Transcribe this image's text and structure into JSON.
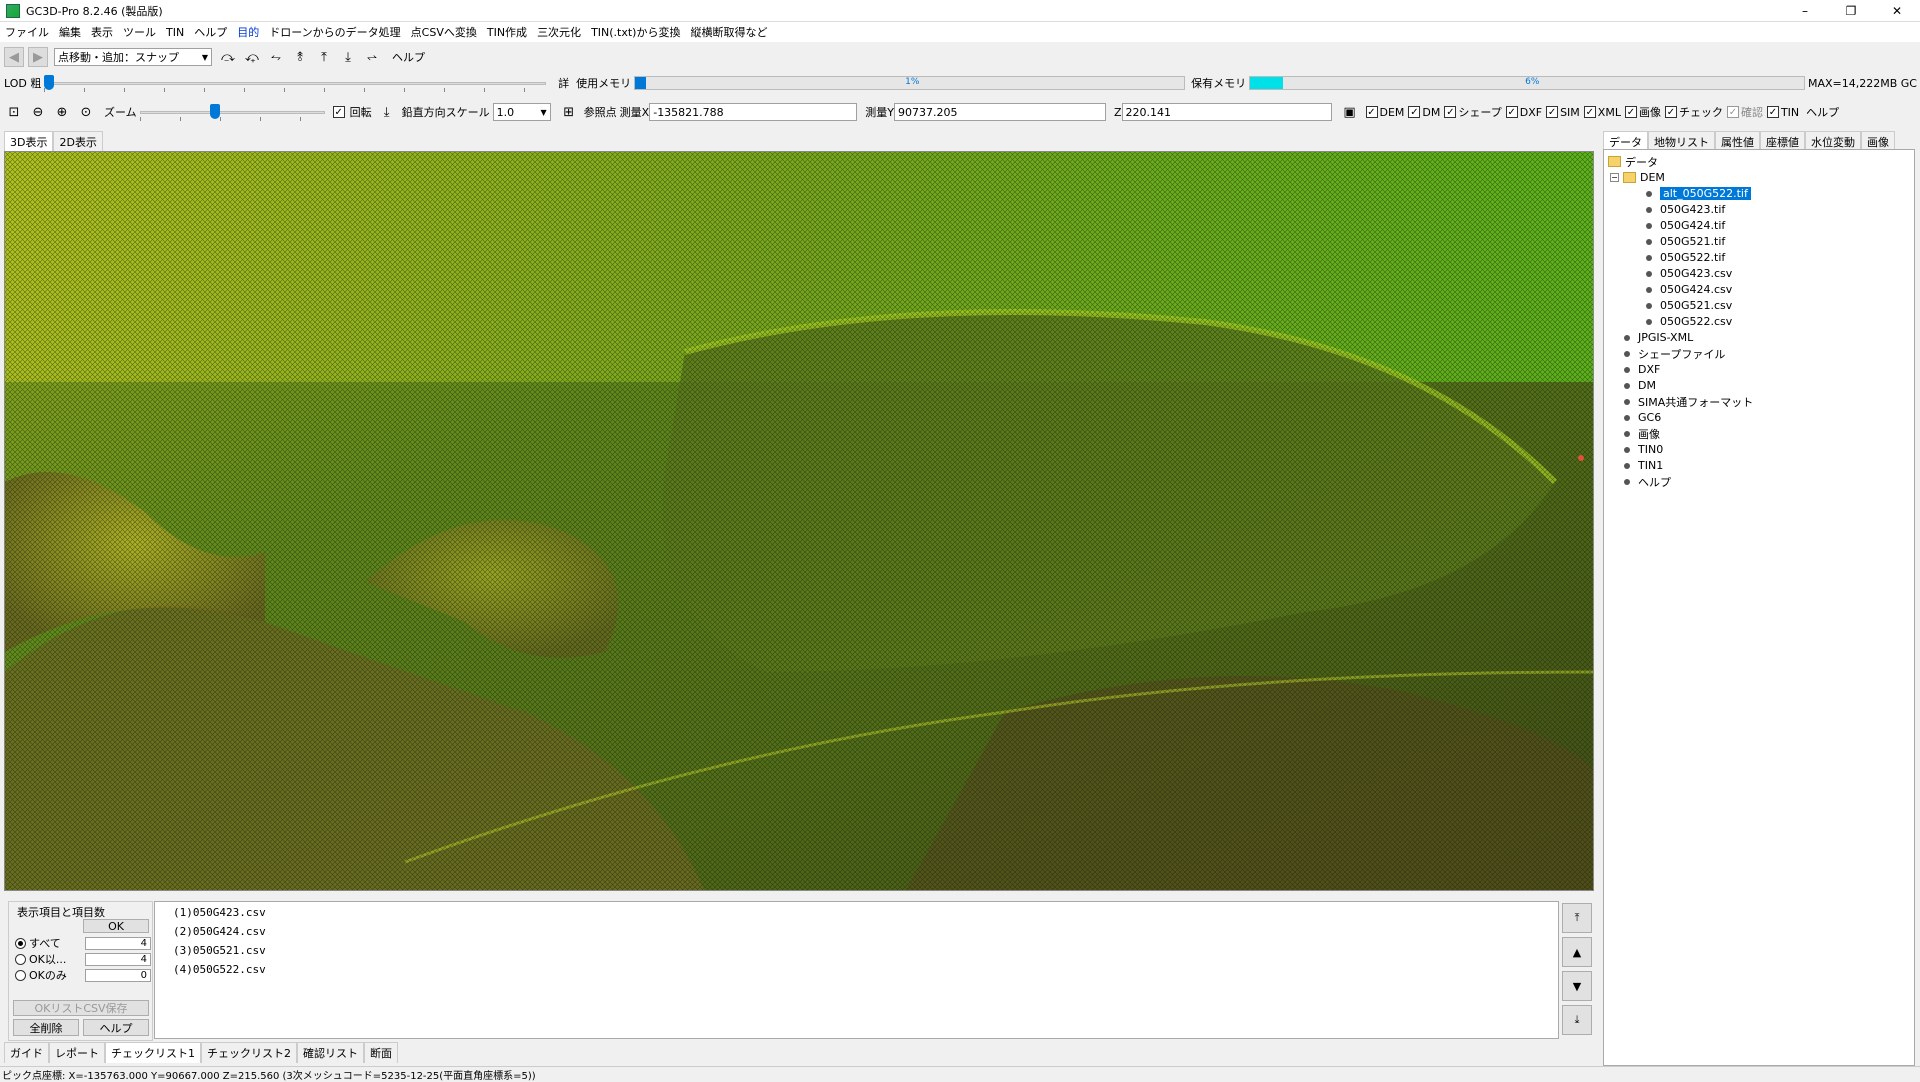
{
  "window": {
    "title": "GC3D-Pro 8.2.46 (製品版)",
    "min": "–",
    "max": "❐",
    "close": "✕"
  },
  "menu": [
    "ファイル",
    "編集",
    "表示",
    "ツール",
    "TIN",
    "ヘルプ",
    "目的",
    "ドローンからのデータ処理",
    "点CSVへ変換",
    "TIN作成",
    "三次元化",
    "TIN(.txt)から変換",
    "縦横断取得など"
  ],
  "toolbar1": {
    "mode": "点移動・追加：スナップ",
    "help": "ヘルプ"
  },
  "lod": {
    "label": "LOD 粗",
    "fine_label": "詳",
    "level": 0.0
  },
  "memory": {
    "used_label": "使用メモリ",
    "used_pct": "1%",
    "used_value": 0.01,
    "held_label": "保有メモリ",
    "held_pct": "6%",
    "held_value": 0.06,
    "max_label": "MAX=14,222MB GC"
  },
  "toolbar2": {
    "zoom_label": "ズーム",
    "zoom_level": 0.4,
    "rotate_label": "回転",
    "rotate_checked": true,
    "vscale_label": "鉛直方向スケール",
    "vscale_value": "1.0",
    "ref_label": "参照点",
    "x_label": "測量X",
    "x_value": "-135821.788",
    "y_label": "測量Y",
    "y_value": "90737.205",
    "z_label": "Z",
    "z_value": "220.141",
    "layers": [
      {
        "label": "DEM",
        "checked": true,
        "enabled": true
      },
      {
        "label": "DM",
        "checked": true,
        "enabled": true
      },
      {
        "label": "シェープ",
        "checked": true,
        "enabled": true
      },
      {
        "label": "DXF",
        "checked": true,
        "enabled": true
      },
      {
        "label": "SIM",
        "checked": true,
        "enabled": true
      },
      {
        "label": "XML",
        "checked": true,
        "enabled": true
      },
      {
        "label": "画像",
        "checked": true,
        "enabled": true
      },
      {
        "label": "チェック",
        "checked": true,
        "enabled": true
      },
      {
        "label": "確認",
        "checked": true,
        "enabled": false
      },
      {
        "label": "TIN",
        "checked": true,
        "enabled": true
      }
    ],
    "help": "ヘルプ"
  },
  "view_tabs": [
    "3D表示",
    "2D表示"
  ],
  "right_tabs": [
    "データ",
    "地物リスト",
    "属性値",
    "座標値",
    "水位変動",
    "画像"
  ],
  "tree": {
    "root": "データ",
    "dem": "DEM",
    "dem_children": [
      "alt_050G522.tif",
      "050G423.tif",
      "050G424.tif",
      "050G521.tif",
      "050G522.tif",
      "050G423.csv",
      "050G424.csv",
      "050G521.csv",
      "050G522.csv"
    ],
    "others": [
      "JPGIS-XML",
      "シェープファイル",
      "DXF",
      "DM",
      "SIMA共通フォーマット",
      "GC6",
      "画像",
      "TIN0",
      "TIN1",
      "ヘルプ"
    ]
  },
  "bottom": {
    "group_title": "表示項目と項目数",
    "ok_button": "OK",
    "radios": [
      {
        "label": "すべて",
        "count": "4",
        "selected": true
      },
      {
        "label": "OK以...",
        "count": "4",
        "selected": false
      },
      {
        "label": "OKのみ",
        "count": "0",
        "selected": false
      }
    ],
    "csv_save": "OKリストCSV保存",
    "delete_all": "全削除",
    "help": "ヘルプ",
    "list": [
      "(1)050G423.csv",
      "(2)050G424.csv",
      "(3)050G521.csv",
      "(4)050G522.csv"
    ],
    "scroll": [
      "⤒",
      "▲",
      "▼",
      "⤓"
    ],
    "tabs": [
      "ガイド",
      "レポート",
      "チェックリスト1",
      "チェックリスト2",
      "確認リスト",
      "断面"
    ]
  },
  "status": "ピック点座標: X=-135763.000 Y=90667.000 Z=215.560 (3次メッシュコード=5235-12-25(平面直角座標系=5))",
  "colors": {
    "accent": "#0078d7",
    "terrain_high": "#c8d020",
    "terrain_mid": "#6a8a1c",
    "terrain_low": "#4a5a18",
    "memory_fill": "#00e0e8"
  }
}
